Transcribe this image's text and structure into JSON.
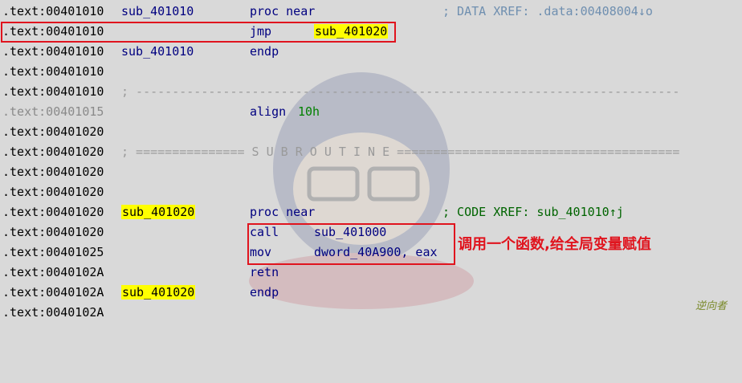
{
  "lines": [
    {
      "addr": ".text:00401010",
      "label": "sub_401010",
      "mnemonic": "proc near",
      "operand": "",
      "comment": "; DATA XREF: .data:00408004↓o"
    },
    {
      "addr": ".text:00401010",
      "label": "",
      "mnemonic": "jmp",
      "operand": "sub_401020",
      "comment": ""
    },
    {
      "addr": ".text:00401010",
      "label": "sub_401010",
      "mnemonic": "endp",
      "operand": "",
      "comment": ""
    },
    {
      "addr": ".text:00401010",
      "label": "",
      "mnemonic": "",
      "operand": "",
      "comment": ""
    },
    {
      "addr": ".text:00401010",
      "sep": "; ---------------------------------------------------------------------------"
    },
    {
      "addr": ".text:00401015",
      "label": "",
      "mnemonic": "align",
      "operand": "10h",
      "comment": ""
    },
    {
      "addr": ".text:00401020",
      "label": "",
      "mnemonic": "",
      "operand": "",
      "comment": ""
    },
    {
      "addr": ".text:00401020",
      "sep": "; =============== S U B R O U T I N E ======================================="
    },
    {
      "addr": ".text:00401020",
      "label": "",
      "mnemonic": "",
      "operand": "",
      "comment": ""
    },
    {
      "addr": ".text:00401020",
      "label": "",
      "mnemonic": "",
      "operand": "",
      "comment": ""
    },
    {
      "addr": ".text:00401020",
      "label": "sub_401020",
      "mnemonic": "proc near",
      "operand": "",
      "comment": "; CODE XREF: sub_401010↑j"
    },
    {
      "addr": ".text:00401020",
      "label": "",
      "mnemonic": "call",
      "operand": "sub_401000",
      "comment": ""
    },
    {
      "addr": ".text:00401025",
      "label": "",
      "mnemonic": "mov",
      "operand": "dword_40A900, eax",
      "comment": ""
    },
    {
      "addr": ".text:0040102A",
      "label": "",
      "mnemonic": "retn",
      "operand": "",
      "comment": ""
    },
    {
      "addr": ".text:0040102A",
      "label": "sub_401020",
      "mnemonic": "endp",
      "operand": "",
      "comment": ""
    },
    {
      "addr": ".text:0040102A",
      "label": "",
      "mnemonic": "",
      "operand": "",
      "comment": ""
    }
  ],
  "annotation": "调用一个函数,给全局变量赋值",
  "watermark": "逆向者",
  "colors": {
    "highlight": "#ffff00",
    "redbox": "#e0141e",
    "keyword": "#000080",
    "comment_green": "#006400"
  }
}
